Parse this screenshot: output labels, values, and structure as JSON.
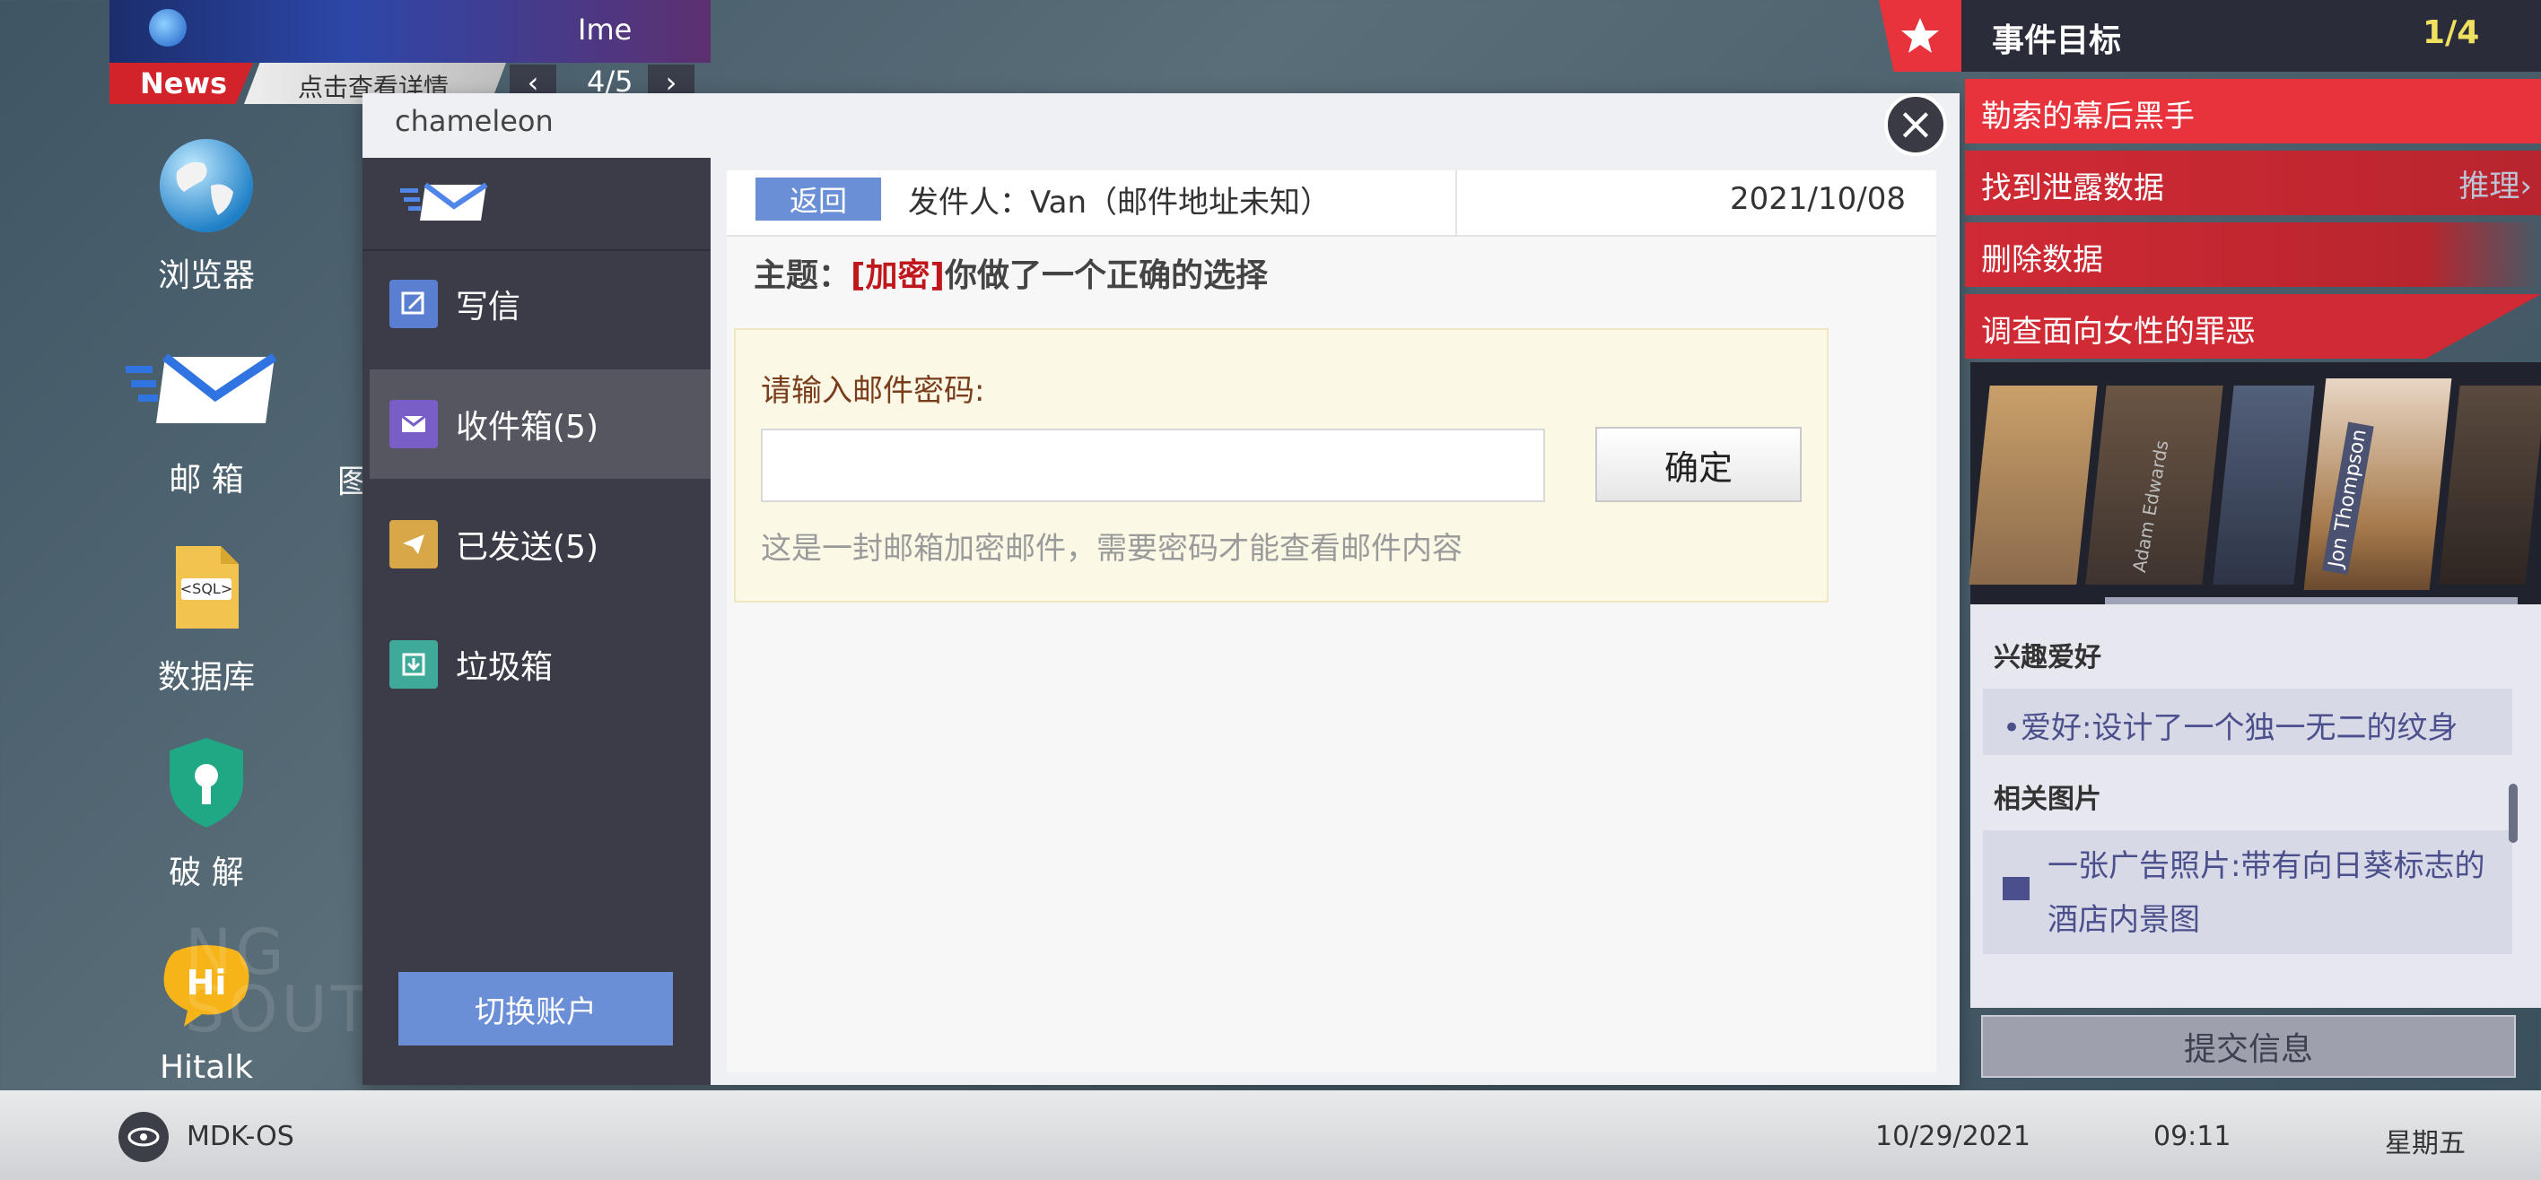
{
  "desktop": {
    "icons": [
      {
        "label": "浏览器",
        "icon": "globe-icon"
      },
      {
        "label": "邮 箱",
        "icon": "mail-icon"
      },
      {
        "label": "数据库",
        "icon": "sql-file-icon"
      },
      {
        "label": "破 解",
        "icon": "shield-keyhole-icon"
      },
      {
        "label": "Hitalk",
        "icon": "hitalk-bubble-icon"
      }
    ],
    "partial_label": "图",
    "bg_text": "NG SOUT"
  },
  "news": {
    "badge": "News",
    "headline_partial": "Ime",
    "detail_link": "点击查看详情",
    "page": "4/5"
  },
  "mail_window": {
    "title": "chameleon",
    "sidebar": {
      "items": [
        {
          "label": "写信",
          "icon": "compose-icon",
          "color": "#5b7fd0"
        },
        {
          "label": "收件箱(5)",
          "icon": "inbox-icon",
          "color": "#7a5ec8",
          "selected": true
        },
        {
          "label": "已发送(5)",
          "icon": "sent-icon",
          "color": "#d8a848"
        },
        {
          "label": "垃圾箱",
          "icon": "trash-icon",
          "color": "#3fa99a"
        }
      ],
      "switch_account": "切换账户"
    },
    "message": {
      "back": "返回",
      "sender": "发件人：Van（邮件地址未知）",
      "date": "2021/10/08",
      "subject_prefix": "主题：",
      "subject_tag": "[加密]",
      "subject_text": "你做了一个正确的选择",
      "password_prompt": "请输入邮件密码:",
      "password_value": "",
      "confirm": "确定",
      "hint": "这是一封邮箱加密邮件，需要密码才能查看邮件内容"
    }
  },
  "objectives": {
    "title": "事件目标",
    "progress": "1/4",
    "items": [
      {
        "label": "勒索的幕后黑手",
        "active": true
      },
      {
        "label": "找到泄露数据",
        "action": "推理›"
      },
      {
        "label": "删除数据"
      },
      {
        "label": "调查面向女性的罪恶"
      }
    ]
  },
  "profile": {
    "names": [
      "Adam Edwards",
      "Jon Thompson"
    ],
    "sections": [
      {
        "heading": "兴趣爱好",
        "entries": [
          "•爱好:设计了一个独一无二的纹身"
        ]
      },
      {
        "heading": "相关图片",
        "entries": [
          "一张广告照片:带有向日葵标志的酒店内景图"
        ]
      }
    ],
    "submit": "提交信息"
  },
  "taskbar": {
    "os": "MDK-OS",
    "date": "10/29/2021",
    "time": "09:11",
    "weekday": "星期五"
  },
  "colors": {
    "accent_red": "#e8323c",
    "mail_blue": "#6b8fd6",
    "subject_tag": "#c0171d",
    "objective_highlight": "#f0e060"
  }
}
